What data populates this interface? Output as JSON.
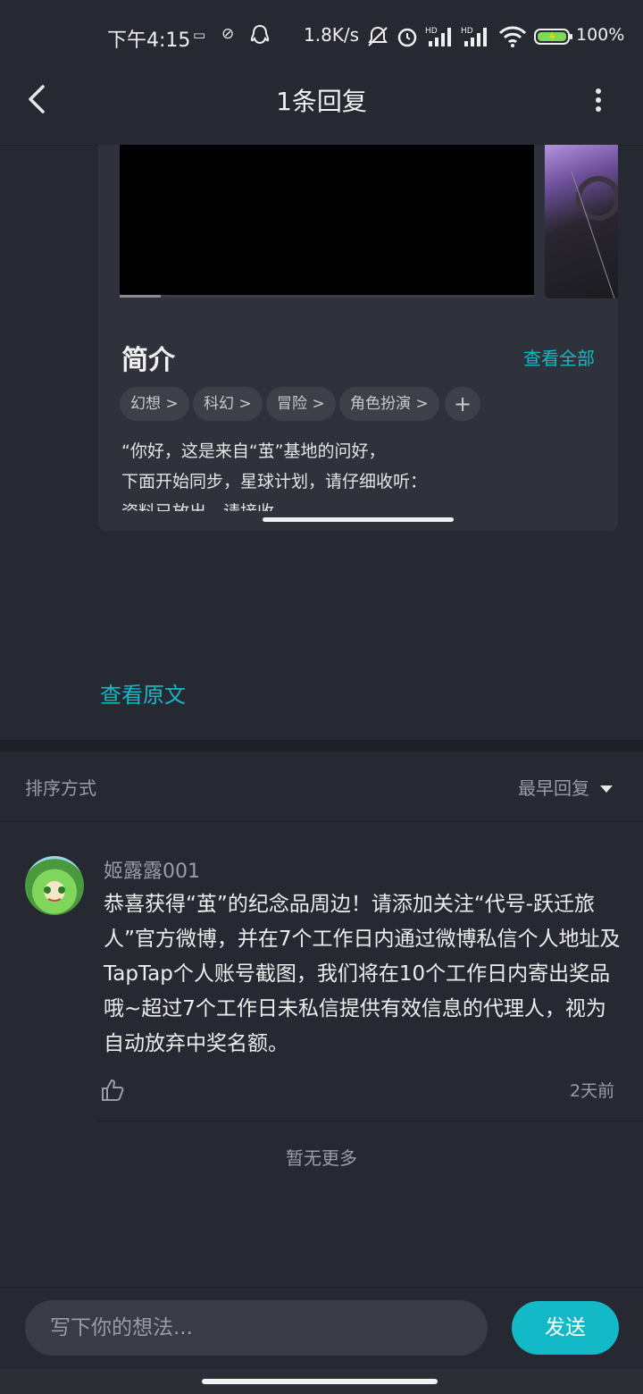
{
  "status_bar": {
    "time": "下午4:15",
    "net_speed": "1.8K/s",
    "battery": "100%"
  },
  "nav": {
    "title": "1条回复"
  },
  "card": {
    "intro_title": "简介",
    "view_all": "查看全部",
    "tags": [
      "幻想 >",
      "科幻 >",
      "冒险 >",
      "角色扮演 >"
    ],
    "add_tag": "+",
    "intro_line1": "“你好，这是来自“茧”基地的问好，",
    "intro_line2": "下面开始同步，星球计划，请仔细收听：",
    "intro_line3": "资料已放出，请接收…"
  },
  "view_original": "查看原文",
  "sort": {
    "label": "排序方式",
    "value": "最早回复"
  },
  "reply": {
    "username": "姬露露001",
    "text": "恭喜获得“茧”的纪念品周边！请添加关注“代号-跃迁旅人”官方微博，并在7个工作日内通过微博私信个人地址及TapTap个人账号截图，我们将在10个工作日内寄出奖品哦~超过7个工作日未私信提供有效信息的代理人，视为自动放弃中奖名额。",
    "time_ago": "2天前"
  },
  "no_more": "暂无更多",
  "composer": {
    "placeholder": "写下你的想法...",
    "send": "发送"
  },
  "colors": {
    "accent": "#14b9c8",
    "background": "#262932"
  }
}
